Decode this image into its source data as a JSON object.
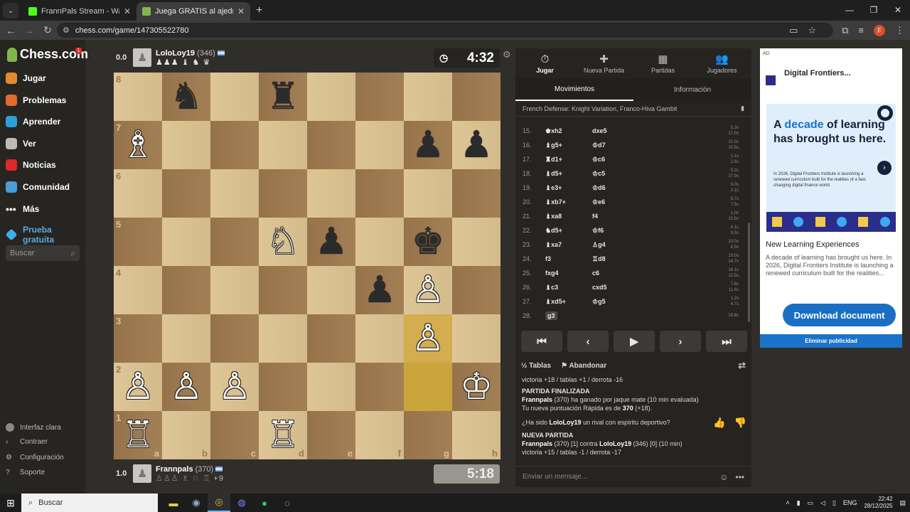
{
  "browser": {
    "tabs": [
      {
        "title": "FrannPals Stream - Watch Live o",
        "active": false,
        "favicon_color": "#53fc18"
      },
      {
        "title": "Juega GRATIS al ajedrez online",
        "active": true,
        "favicon_color": "#81b64c"
      }
    ],
    "url": "chess.com/game/147305522780",
    "profile_initial": "F"
  },
  "sidebar": {
    "logo": "Chess.com",
    "badge": "1",
    "items": [
      {
        "label": "Jugar",
        "color": "#e5892f"
      },
      {
        "label": "Problemas",
        "color": "#e36a2a"
      },
      {
        "label": "Aprender",
        "color": "#2c9fd9"
      },
      {
        "label": "Ver",
        "color": "#bdbbb8"
      },
      {
        "label": "Noticias",
        "color": "#e02828"
      },
      {
        "label": "Comunidad",
        "color": "#4b9bd4"
      },
      {
        "label": "Más",
        "color": "#bdbbb8"
      },
      {
        "label": "Prueba gratuita",
        "color": "#5fa8e0"
      }
    ],
    "search_placeholder": "Buscar",
    "bottom": [
      "Interfaz clara",
      "Contraer",
      "Configuración",
      "Soporte"
    ]
  },
  "top_player": {
    "score": "0.0",
    "name": "LoloLoy19",
    "rating": "(346)",
    "captured": "♟♟♟ ♝ ♞ ♛",
    "clock": "4:32"
  },
  "bottom_player": {
    "score": "1.0",
    "name": "Frannpals",
    "rating": "(370)",
    "captured": "♙♙♙ ♗ ♘ ♖",
    "extra": "+9",
    "clock": "5:18"
  },
  "board": {
    "files": [
      "a",
      "b",
      "c",
      "d",
      "e",
      "f",
      "g",
      "h"
    ],
    "ranks": [
      "8",
      "7",
      "6",
      "5",
      "4",
      "3",
      "2",
      "1"
    ],
    "pieces": {
      "b8": "♞b",
      "d8": "♜b",
      "a7": "♗w",
      "g7": "♟b",
      "h7": "♟b",
      "d5": "♘w",
      "e5": "♟b",
      "g5": "♚b",
      "f4": "♟b",
      "g4": "♙w",
      "g3": "♙w",
      "a2": "♙w",
      "b2": "♙w",
      "c2": "♙w",
      "h2": "♔w",
      "a1": "♖w",
      "d1": "♖w"
    },
    "highlights": [
      "g3",
      "g2"
    ]
  },
  "panel": {
    "tabs": [
      {
        "label": "Jugar",
        "icon": "⏱"
      },
      {
        "label": "Nueva Partida",
        "icon": "✚"
      },
      {
        "label": "Partidas",
        "icon": "▦"
      },
      {
        "label": "Jugadores",
        "icon": "👥"
      }
    ],
    "subtabs": [
      "Movimientos",
      "Información"
    ],
    "opening": "French Defense: Knight Variation, Franco-Hiva Gambit",
    "moves": [
      {
        "n": "15.",
        "w": "♚xh2",
        "b": "dxe5",
        "tw": "5.3s",
        "tb": "17.0s"
      },
      {
        "n": "16.",
        "w": "♝g5+",
        "b": "♔d7",
        "tw": "21.0s",
        "tb": "10.5s"
      },
      {
        "n": "17.",
        "w": "♜d1+",
        "b": "♔c6",
        "tw": "1.1s",
        "tb": "2.6s"
      },
      {
        "n": "18.",
        "w": "♝d5+",
        "b": "♔c5",
        "tw": "5.2s",
        "tb": "17.9s"
      },
      {
        "n": "19.",
        "w": "♝e3+",
        "b": "♔d6",
        "tw": "9.0s",
        "tb": "2.1s"
      },
      {
        "n": "20.",
        "w": "♝xb7+",
        "b": "♔e6",
        "tw": "8.7s",
        "tb": "7.5s"
      },
      {
        "n": "21.",
        "w": "♝xa8",
        "b": "f4",
        "tw": "1.0s",
        "tb": "10.5s"
      },
      {
        "n": "22.",
        "w": "♞d5+",
        "b": "♔f6",
        "tw": "4.1s",
        "tb": "9.5s"
      },
      {
        "n": "23.",
        "w": "♝xa7",
        "b": "♙g4",
        "tw": "10.0s",
        "tb": "6.5s"
      },
      {
        "n": "24.",
        "w": "f3",
        "b": "♖d8",
        "tw": "10.0s",
        "tb": "24.7s"
      },
      {
        "n": "25.",
        "w": "fxg4",
        "b": "c6",
        "tw": "16.1s",
        "tb": "12.5s"
      },
      {
        "n": "26.",
        "w": "♝c3",
        "b": "cxd5",
        "tw": "7.8s",
        "tb": "11.4s"
      },
      {
        "n": "27.",
        "w": "♝xd5+",
        "b": "♔g5",
        "tw": "1.2s",
        "tb": "4.7s"
      },
      {
        "n": "28.",
        "w": "g3",
        "b": "",
        "tw": "19.8s",
        "tb": ""
      }
    ],
    "controls": [
      "⏮",
      "‹",
      "▶",
      "›",
      "⏭"
    ],
    "draw_label": "Tablas",
    "resign_label": "Abandonar",
    "log": {
      "record_top": "victoria +18 / tablas +1 / derrota -16",
      "finished_title": "PARTIDA FINALIZADA",
      "finished_line1": "ha ganado por jaque mate (10 min evaluada)",
      "finished_name": "Frannpals",
      "finished_rating": "(370)",
      "new_rating_pre": "Tu nueva puntuación Rápida es de",
      "new_rating_val": "370",
      "new_rating_post": "(+18).",
      "question_pre": "¿Ha sido",
      "question_name": "LoloLoy19",
      "question_post": "un rival con espíritu deportivo?",
      "new_title": "NUEVA PARTIDA",
      "new_line_a": "Frannpals",
      "new_line_b": "(370) [1] contra",
      "new_line_c": "LoloLoy19",
      "new_line_d": "(346) [0] (10 min)",
      "record_bottom": "victoria +15 / tablas -1 / derrota -17"
    },
    "chat_placeholder": "Enviar un mensaje..."
  },
  "ad": {
    "label": "AD",
    "brand": "Digital Frontiers...",
    "headline_a": "A",
    "headline_blue": "decade",
    "headline_b": "of learning has brought us here.",
    "body": "In 2026, Digital Frontiers Institute is launching a renewed curriculum built for the realities of a fast-changing digital finance world.",
    "title": "New Learning Experiences",
    "desc": "A decade of learning has brought us here. In 2026, Digital Frontiers Institute is launching a renewed curriculum built for the realities...",
    "cta": "Download document",
    "remove": "Eliminar publicidad"
  },
  "taskbar": {
    "search": "Buscar",
    "lang": "ENG",
    "time": "22:42",
    "date": "28/12/2025"
  }
}
